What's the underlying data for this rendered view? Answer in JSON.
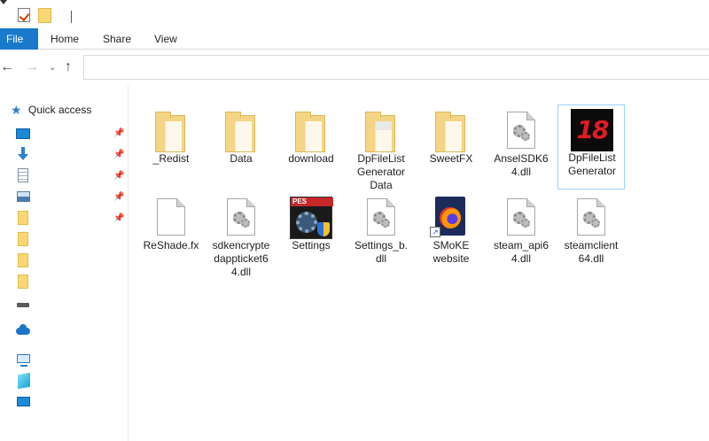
{
  "ribbon": {
    "tabs": [
      "File",
      "Home",
      "Share",
      "View"
    ]
  },
  "nav": {
    "back": "←",
    "forward": "→",
    "recent": "⌄",
    "up": "↑",
    "address": ""
  },
  "sidebar": {
    "quick_access": "Quick access",
    "items": [
      {
        "icon": "desktop-icon",
        "pinned": true
      },
      {
        "icon": "downloads-icon",
        "pinned": true
      },
      {
        "icon": "documents-icon",
        "pinned": true
      },
      {
        "icon": "pictures-icon",
        "pinned": true
      },
      {
        "icon": "folder-icon",
        "pinned": true
      },
      {
        "icon": "folder-icon",
        "pinned": false
      },
      {
        "icon": "folder-icon",
        "pinned": false
      },
      {
        "icon": "folder-icon",
        "pinned": false
      },
      {
        "icon": "drive-icon",
        "pinned": false
      },
      {
        "icon": "onedrive-icon",
        "pinned": false
      },
      {
        "icon": "this-pc-icon",
        "pinned": false
      },
      {
        "icon": "3d-objects-icon",
        "pinned": false
      },
      {
        "icon": "desktop-icon",
        "pinned": false
      }
    ]
  },
  "files": [
    {
      "name": "_Redist",
      "type": "folder"
    },
    {
      "name": "Data",
      "type": "folder"
    },
    {
      "name": "download",
      "type": "folder"
    },
    {
      "name": "DpFileListGeneratorData",
      "type": "folder-docs"
    },
    {
      "name": "SweetFX",
      "type": "folder"
    },
    {
      "name": "AnselSDK64.dll",
      "type": "dll"
    },
    {
      "name": "DpFileList Generator",
      "type": "app18",
      "selected": true
    },
    {
      "name": "ReShade.fx",
      "type": "file"
    },
    {
      "name": "sdkencryptedappticket64.dll",
      "type": "dll"
    },
    {
      "name": "Settings",
      "type": "pes"
    },
    {
      "name": "Settings_b.dll",
      "type": "dll"
    },
    {
      "name": "SMoKE website",
      "type": "firefox"
    },
    {
      "name": "steam_api64.dll",
      "type": "dll"
    },
    {
      "name": "steamclient64.dll",
      "type": "dll"
    }
  ],
  "icons": {
    "app18_text": "18",
    "pes_text": "PES"
  },
  "colors": {
    "file_tab": "#1979ca",
    "selection_border": "#99d1ff",
    "folder": "#f4d585"
  }
}
